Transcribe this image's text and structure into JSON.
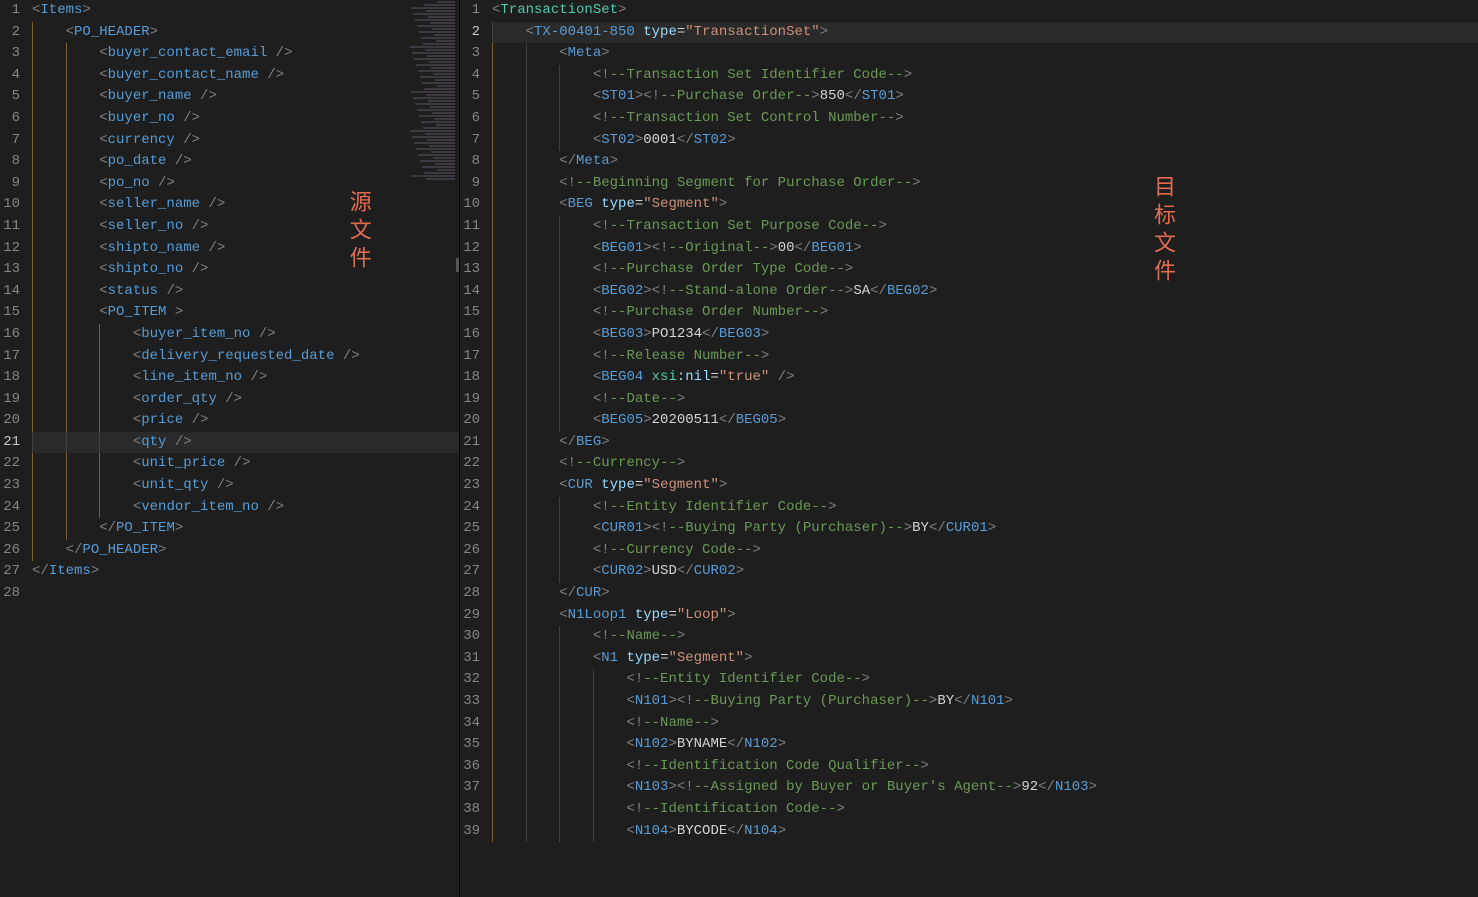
{
  "annotations": {
    "left_label": "源文件",
    "right_label": "目标文件"
  },
  "left": {
    "highlighted_line": 21,
    "lines": [
      {
        "n": 1,
        "indent": 0,
        "open": "Items"
      },
      {
        "n": 2,
        "indent": 1,
        "open": "PO_HEADER"
      },
      {
        "n": 3,
        "indent": 2,
        "self": "buyer_contact_email"
      },
      {
        "n": 4,
        "indent": 2,
        "self": "buyer_contact_name"
      },
      {
        "n": 5,
        "indent": 2,
        "self": "buyer_name"
      },
      {
        "n": 6,
        "indent": 2,
        "self": "buyer_no"
      },
      {
        "n": 7,
        "indent": 2,
        "self": "currency"
      },
      {
        "n": 8,
        "indent": 2,
        "self": "po_date"
      },
      {
        "n": 9,
        "indent": 2,
        "self": "po_no"
      },
      {
        "n": 10,
        "indent": 2,
        "self": "seller_name"
      },
      {
        "n": 11,
        "indent": 2,
        "self": "seller_no"
      },
      {
        "n": 12,
        "indent": 2,
        "self": "shipto_name"
      },
      {
        "n": 13,
        "indent": 2,
        "self": "shipto_no"
      },
      {
        "n": 14,
        "indent": 2,
        "self": "status"
      },
      {
        "n": 15,
        "indent": 2,
        "open": "PO_ITEM",
        "space": true
      },
      {
        "n": 16,
        "indent": 3,
        "self": "buyer_item_no"
      },
      {
        "n": 17,
        "indent": 3,
        "self": "delivery_requested_date"
      },
      {
        "n": 18,
        "indent": 3,
        "self": "line_item_no"
      },
      {
        "n": 19,
        "indent": 3,
        "self": "order_qty"
      },
      {
        "n": 20,
        "indent": 3,
        "self": "price"
      },
      {
        "n": 21,
        "indent": 3,
        "self": "qty"
      },
      {
        "n": 22,
        "indent": 3,
        "self": "unit_price"
      },
      {
        "n": 23,
        "indent": 3,
        "self": "unit_qty"
      },
      {
        "n": 24,
        "indent": 3,
        "self": "vendor_item_no"
      },
      {
        "n": 25,
        "indent": 2,
        "close": "PO_ITEM"
      },
      {
        "n": 26,
        "indent": 1,
        "close": "PO_HEADER"
      },
      {
        "n": 27,
        "indent": 0,
        "close": "Items"
      },
      {
        "n": 28,
        "indent": 0
      }
    ]
  },
  "right": {
    "highlighted_line": 2,
    "lines": [
      {
        "n": 1,
        "indent": 0,
        "open": "TransactionSet",
        "teal": true
      },
      {
        "n": 2,
        "indent": 1,
        "open": "TX-00401-850",
        "attrs": [
          [
            "type",
            "TransactionSet"
          ]
        ]
      },
      {
        "n": 3,
        "indent": 2,
        "open": "Meta"
      },
      {
        "n": 4,
        "indent": 3,
        "comment": "Transaction Set Identifier Code"
      },
      {
        "n": 5,
        "indent": 3,
        "elem": "ST01",
        "midcomment": "Purchase Order",
        "text": "850"
      },
      {
        "n": 6,
        "indent": 3,
        "comment": "Transaction Set Control Number"
      },
      {
        "n": 7,
        "indent": 3,
        "elem": "ST02",
        "text": "0001"
      },
      {
        "n": 8,
        "indent": 2,
        "close": "Meta"
      },
      {
        "n": 9,
        "indent": 2,
        "comment": "Beginning Segment for Purchase Order"
      },
      {
        "n": 10,
        "indent": 2,
        "open": "BEG",
        "attrs": [
          [
            "type",
            "Segment"
          ]
        ]
      },
      {
        "n": 11,
        "indent": 3,
        "comment": "Transaction Set Purpose Code"
      },
      {
        "n": 12,
        "indent": 3,
        "elem": "BEG01",
        "midcomment": "Original",
        "text": "00"
      },
      {
        "n": 13,
        "indent": 3,
        "comment": "Purchase Order Type Code"
      },
      {
        "n": 14,
        "indent": 3,
        "elem": "BEG02",
        "midcomment": "Stand-alone Order",
        "text": "SA"
      },
      {
        "n": 15,
        "indent": 3,
        "comment": "Purchase Order Number"
      },
      {
        "n": 16,
        "indent": 3,
        "elem": "BEG03",
        "text": "PO1234"
      },
      {
        "n": 17,
        "indent": 3,
        "comment": "Release Number"
      },
      {
        "n": 18,
        "indent": 3,
        "self": "BEG04",
        "nsattr": [
          "xsi",
          "nil",
          "true"
        ]
      },
      {
        "n": 19,
        "indent": 3,
        "comment": "Date"
      },
      {
        "n": 20,
        "indent": 3,
        "elem": "BEG05",
        "text": "20200511"
      },
      {
        "n": 21,
        "indent": 2,
        "close": "BEG"
      },
      {
        "n": 22,
        "indent": 2,
        "comment": "Currency"
      },
      {
        "n": 23,
        "indent": 2,
        "open": "CUR",
        "attrs": [
          [
            "type",
            "Segment"
          ]
        ]
      },
      {
        "n": 24,
        "indent": 3,
        "comment": "Entity Identifier Code"
      },
      {
        "n": 25,
        "indent": 3,
        "elem": "CUR01",
        "midcomment": "Buying Party (Purchaser)",
        "text": "BY"
      },
      {
        "n": 26,
        "indent": 3,
        "comment": "Currency Code"
      },
      {
        "n": 27,
        "indent": 3,
        "elem": "CUR02",
        "text": "USD"
      },
      {
        "n": 28,
        "indent": 2,
        "close": "CUR"
      },
      {
        "n": 29,
        "indent": 2,
        "open": "N1Loop1",
        "attrs": [
          [
            "type",
            "Loop"
          ]
        ]
      },
      {
        "n": 30,
        "indent": 3,
        "comment": "Name"
      },
      {
        "n": 31,
        "indent": 3,
        "open": "N1",
        "attrs": [
          [
            "type",
            "Segment"
          ]
        ]
      },
      {
        "n": 32,
        "indent": 4,
        "comment": "Entity Identifier Code"
      },
      {
        "n": 33,
        "indent": 4,
        "elem": "N101",
        "midcomment": "Buying Party (Purchaser)",
        "text": "BY"
      },
      {
        "n": 34,
        "indent": 4,
        "comment": "Name"
      },
      {
        "n": 35,
        "indent": 4,
        "elem": "N102",
        "text": "BYNAME"
      },
      {
        "n": 36,
        "indent": 4,
        "comment": "Identification Code Qualifier"
      },
      {
        "n": 37,
        "indent": 4,
        "elem": "N103",
        "midcomment": "Assigned by Buyer or Buyer&apos;s Agent",
        "text": "92"
      },
      {
        "n": 38,
        "indent": 4,
        "comment": "Identification Code"
      },
      {
        "n": 39,
        "indent": 4,
        "elem": "N104",
        "text": "BYCODE"
      }
    ]
  }
}
